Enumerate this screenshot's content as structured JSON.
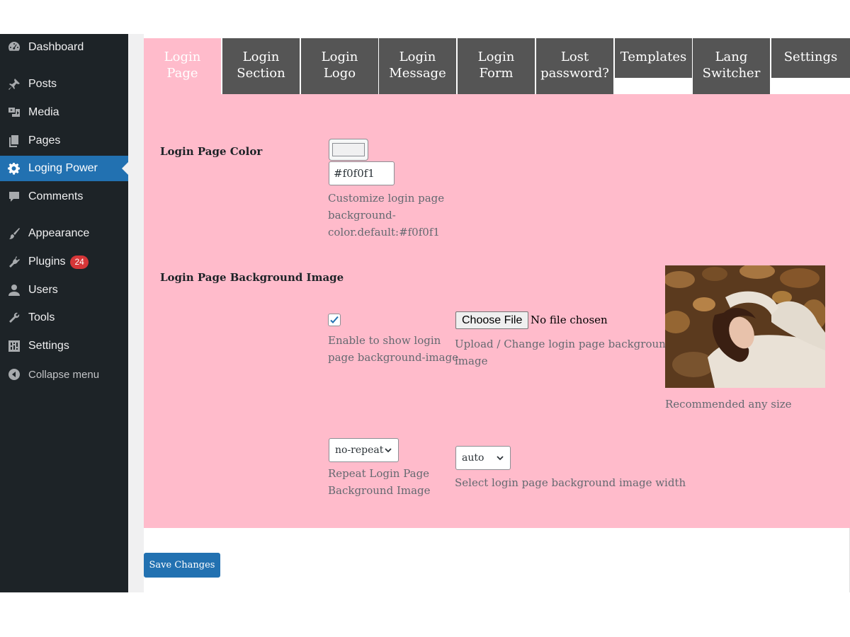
{
  "sidebar": {
    "items": [
      {
        "label": "Dashboard",
        "icon": "dashboard-icon"
      },
      {
        "label": "Posts",
        "icon": "pushpin-icon"
      },
      {
        "label": "Media",
        "icon": "media-icon"
      },
      {
        "label": "Pages",
        "icon": "pages-icon"
      },
      {
        "label": "Loging Power",
        "icon": "gear-icon",
        "active": true
      },
      {
        "label": "Comments",
        "icon": "comment-icon"
      },
      {
        "label": "Appearance",
        "icon": "paintbrush-icon"
      },
      {
        "label": "Plugins",
        "icon": "plugin-icon",
        "badge": "24"
      },
      {
        "label": "Users",
        "icon": "user-icon"
      },
      {
        "label": "Tools",
        "icon": "wrench-icon"
      },
      {
        "label": "Settings",
        "icon": "settings-sliders-icon"
      }
    ],
    "collapse_label": "Collapse menu",
    "badge_color": "#d63638",
    "active_color": "#2271b1"
  },
  "tabs": [
    {
      "line1": "Login",
      "line2": "Page",
      "current": true
    },
    {
      "line1": "Login",
      "line2": "Section"
    },
    {
      "line1": "Login",
      "line2": "Logo"
    },
    {
      "line1": "Login",
      "line2": "Message"
    },
    {
      "line1": "Login",
      "line2": "Form"
    },
    {
      "line1": "Lost",
      "line2": "password?"
    },
    {
      "line1": "Templates",
      "line2": ""
    },
    {
      "line1": "Lang",
      "line2": "Switcher"
    },
    {
      "line1": "Settings",
      "line2": ""
    }
  ],
  "form": {
    "color": {
      "label": "Login Page Color",
      "value": "#f0f0f1",
      "desc1": "Customize login page",
      "desc2": "background-",
      "desc3": "color.default:#f0f0f1"
    },
    "bg_image": {
      "label": "Login Page Background Image",
      "enable_checked": true,
      "enable_desc1": "Enable to show login",
      "enable_desc2": "page background-image",
      "choose_file_label": "Choose File",
      "file_status": "No file chosen",
      "upload_desc1": "Upload / Change login page background",
      "upload_desc2": "image",
      "recommend": "Recommended any size"
    },
    "repeat": {
      "value": "no-repeat",
      "desc1": "Repeat Login Page",
      "desc2": "Background Image"
    },
    "width": {
      "value": "auto",
      "desc": "Select login page background image width"
    }
  },
  "save_label": "Save Changes",
  "colors": {
    "panel_bg": "#ffbbcb",
    "tab_bg": "#555555",
    "sidebar_bg": "#1d2327"
  }
}
